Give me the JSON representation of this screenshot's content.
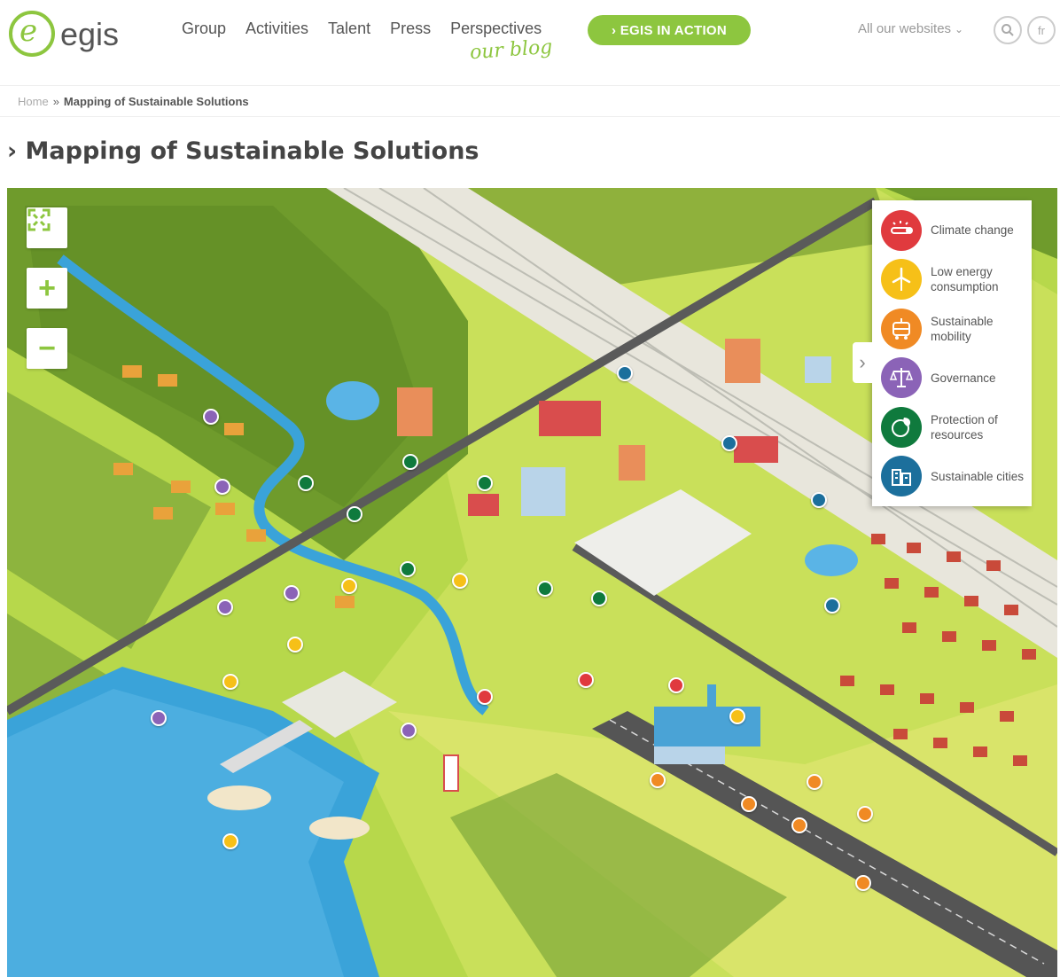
{
  "header": {
    "logo_text": "egis",
    "nav": [
      "Group",
      "Activities",
      "Talent",
      "Press",
      "Perspectives"
    ],
    "blog_script": "our blog",
    "action_button": "› EGIS IN ACTION",
    "all_websites": "All our websites",
    "lang": "fr"
  },
  "breadcrumb": {
    "home": "Home",
    "separator": "»",
    "current": "Mapping of Sustainable Solutions"
  },
  "page_title": "› Mapping of Sustainable Solutions",
  "map": {
    "controls": {
      "fullscreen": "fullscreen-icon",
      "zoom_in": "+",
      "zoom_out": "−"
    },
    "legend": [
      {
        "label": "Climate change",
        "color": "#e03a3e",
        "icon": "thermometer-icon"
      },
      {
        "label": "Low energy consumption",
        "color": "#f6c018",
        "icon": "wind-turbine-icon"
      },
      {
        "label": "Sustainable mobility",
        "color": "#f08a24",
        "icon": "tram-icon"
      },
      {
        "label": "Governance",
        "color": "#8b63b7",
        "icon": "scales-icon"
      },
      {
        "label": "Protection of resources",
        "color": "#0f7a3d",
        "icon": "globe-leaf-icon"
      },
      {
        "label": "Sustainable cities",
        "color": "#1c6f9c",
        "icon": "buildings-icon"
      }
    ],
    "colors": {
      "grass": "#b7d84b",
      "forest": "#6f9b2c",
      "water": "#3aa3d9",
      "road": "#5a5a5a"
    }
  }
}
